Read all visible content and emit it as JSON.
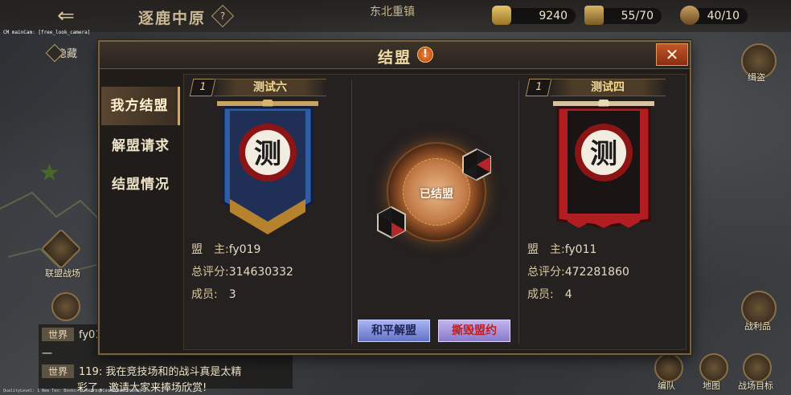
{
  "topbar": {
    "location": "逐鹿中原",
    "help": "?",
    "region": "东北重镇",
    "gold": "9240",
    "orders": "55/70",
    "troops": "40/10"
  },
  "debug": {
    "top": "CM mainCam: [free_look_camera]",
    "bottom": "QualityLevel: 1  New Tex: Books: 1  RefreshCache(Real-time) ..."
  },
  "map": {
    "hidden_label": "隐藏",
    "right_top_label": "缉盗",
    "left_battle_label": "联盟战场",
    "loot_label": "战利品",
    "bottom_buttons": [
      "编队",
      "地图",
      "战场目标"
    ]
  },
  "chat": {
    "rows": [
      {
        "channel": "世界",
        "text": "fy01"
      },
      {
        "channel": "",
        "text": "一"
      },
      {
        "channel": "世界",
        "text": "119: 我在竞技场和的战斗真是太精"
      },
      {
        "channel": "",
        "text": "彩了，邀请大家来捧场欣赏!"
      }
    ]
  },
  "modal": {
    "title": "结盟",
    "warn": "!",
    "close": "✕",
    "tabs": [
      "我方结盟",
      "解盟请求",
      "结盟情况"
    ],
    "status": "已结盟",
    "peace_button": "和平解盟",
    "break_button": "撕毁盟约",
    "left": {
      "rank": "1",
      "name": "测试六",
      "banner_char": "测",
      "leader_label": "盟　主:",
      "leader": "fy019",
      "score_label": "总评分:",
      "score": "314630332",
      "members_label": "成员:",
      "members": "3",
      "banner_color": "#2f5da5"
    },
    "right": {
      "rank": "1",
      "name": "测试四",
      "banner_char": "测",
      "leader_label": "盟　主:",
      "leader": "fy011",
      "score_label": "总评分:",
      "score": "472281860",
      "members_label": "成员:",
      "members": "4",
      "banner_color": "#b01e22"
    }
  }
}
